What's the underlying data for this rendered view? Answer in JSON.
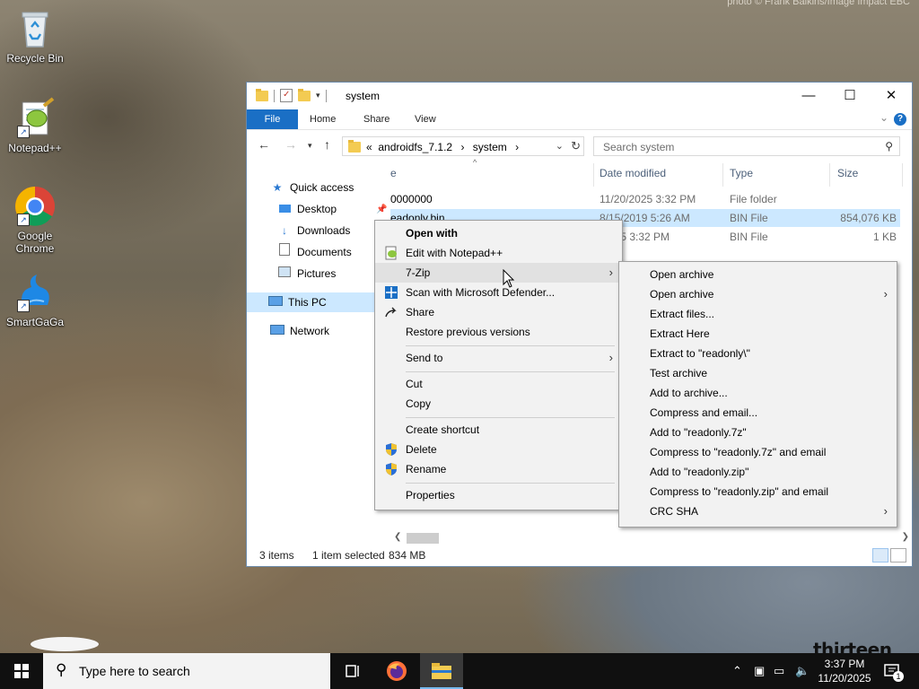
{
  "desktop": {
    "photo_credit": "photo © Frank Balkins/Image Impact EBC",
    "watermark": "thirteen",
    "icons": [
      {
        "label": "Recycle Bin",
        "icon": "recycle-bin-icon"
      },
      {
        "label": "Notepad++",
        "icon": "notepadpp-icon"
      },
      {
        "label": "Google Chrome",
        "icon": "chrome-icon"
      },
      {
        "label": "SmartGaGa",
        "icon": "smartgaga-icon"
      }
    ]
  },
  "window": {
    "title": "system",
    "ribbon_tabs": [
      "File",
      "Home",
      "Share",
      "View"
    ],
    "accent": "#1a6fc5",
    "breadcrumb": {
      "prefix": "«",
      "parts": [
        "androidfs_7.1.2",
        "system"
      ]
    },
    "search_placeholder": "Search system",
    "nav_items": [
      {
        "label": "Quick access",
        "icon": "star-icon"
      },
      {
        "label": "Desktop",
        "icon": "desktop-icon"
      },
      {
        "label": "Downloads",
        "icon": "download-icon"
      },
      {
        "label": "Documents",
        "icon": "documents-icon"
      },
      {
        "label": "Pictures",
        "icon": "pictures-icon"
      },
      {
        "label": "This PC",
        "icon": "computer-icon",
        "selected": true
      },
      {
        "label": "Network",
        "icon": "network-icon"
      }
    ],
    "columns": [
      "e",
      "Date modified",
      "Type",
      "Size"
    ],
    "files": [
      {
        "name": "0000000",
        "date": "11/20/2025 3:32 PM",
        "type": "File folder",
        "size": ""
      },
      {
        "name": "eadonly.bin",
        "date": "8/15/2019 5:26 AM",
        "type": "BIN File",
        "size": "854,076 KB",
        "selected": true
      },
      {
        "name": "",
        "date": "/2025 3:32 PM",
        "type": "BIN File",
        "size": "1 KB"
      }
    ],
    "status": {
      "items": "3 items",
      "selected": "1 item selected",
      "size": "834 MB"
    }
  },
  "context_menu": {
    "items": [
      {
        "label": "Open with",
        "bold": true
      },
      {
        "label": "Edit with Notepad++",
        "icon": "notepadpp-icon"
      },
      {
        "label": "7-Zip",
        "submenu": true,
        "highlight": true
      },
      {
        "label": "Scan with Microsoft Defender...",
        "icon": "defender-icon"
      },
      {
        "label": "Share",
        "icon": "share-icon"
      },
      {
        "label": "Restore previous versions"
      },
      {
        "sep": true
      },
      {
        "label": "Send to",
        "submenu": true
      },
      {
        "sep": true
      },
      {
        "label": "Cut"
      },
      {
        "label": "Copy"
      },
      {
        "sep": true
      },
      {
        "label": "Create shortcut"
      },
      {
        "label": "Delete",
        "icon": "shield-icon"
      },
      {
        "label": "Rename",
        "icon": "shield-icon"
      },
      {
        "sep": true
      },
      {
        "label": "Properties"
      }
    ]
  },
  "zip_menu": {
    "items": [
      {
        "label": "Open archive"
      },
      {
        "label": "Open archive",
        "submenu": true
      },
      {
        "label": "Extract files..."
      },
      {
        "label": "Extract Here"
      },
      {
        "label": "Extract to \"readonly\\\""
      },
      {
        "label": "Test archive"
      },
      {
        "label": "Add to archive..."
      },
      {
        "label": "Compress and email..."
      },
      {
        "label": "Add to \"readonly.7z\""
      },
      {
        "label": "Compress to \"readonly.7z\" and email"
      },
      {
        "label": "Add to \"readonly.zip\""
      },
      {
        "label": "Compress to \"readonly.zip\" and email"
      },
      {
        "label": "CRC SHA",
        "submenu": true
      }
    ]
  },
  "taskbar": {
    "search_placeholder": "Type here to search",
    "time": "3:37 PM",
    "date": "11/20/2025",
    "notification_count": "1"
  }
}
